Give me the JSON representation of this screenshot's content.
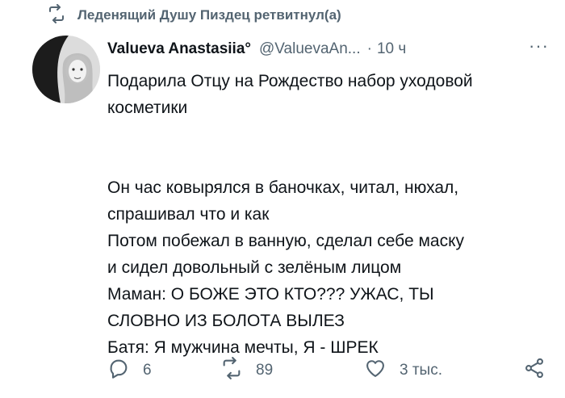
{
  "retweet": {
    "icon": "retweet-icon",
    "text": "Леденящий Душу Пиздец ретвитнул(а)"
  },
  "tweet": {
    "display_name": "Valueva Anastasiia°",
    "handle": "@ValuevaAn...",
    "separator": "·",
    "time": "10 ч",
    "more": "···",
    "lines": [
      "Подарила Отцу на Рождество набор уходовой",
      "косметики",
      "",
      "Он час ковырялся в баночках, читал, нюхал,",
      "спрашивал что и как",
      "Потом побежал в ванную, сделал себе маску",
      "и сидел довольный с зелёным лицом",
      "Маман: О БОЖЕ ЭТО КТО??? УЖАС, ТЫ",
      "СЛОВНО ИЗ БОЛОТА ВЫЛЕЗ",
      "Батя: Я мужчина мечты, Я - ШРЕК"
    ]
  },
  "actions": {
    "reply": {
      "icon": "reply-icon",
      "count": "6"
    },
    "retweet": {
      "icon": "retweet-icon",
      "count": "89"
    },
    "like": {
      "icon": "heart-icon",
      "count": "3 тыс."
    },
    "share": {
      "icon": "share-icon"
    }
  },
  "colors": {
    "text": "#0f1419",
    "secondary": "#536471",
    "background": "#ffffff"
  }
}
